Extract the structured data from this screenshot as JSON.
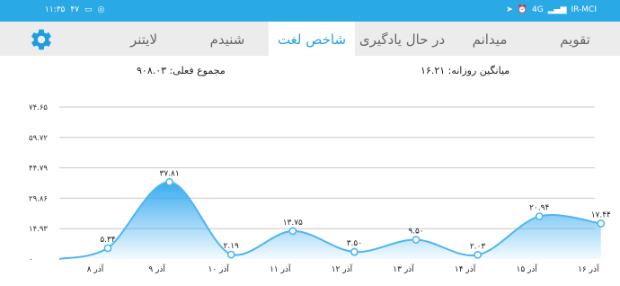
{
  "status_bar": {
    "time": "۱۱:۳۵",
    "data_rate": "۴۷",
    "carrier": "IR-MCI",
    "network_type": "4G"
  },
  "tabs": [
    {
      "label": "تقویم",
      "active": false
    },
    {
      "label": "میدانم",
      "active": false
    },
    {
      "label": "در حال یادگیری",
      "active": false
    },
    {
      "label": "شاخص لغت",
      "active": true
    },
    {
      "label": "شنیدم",
      "active": false
    },
    {
      "label": "لایتنر",
      "active": false
    }
  ],
  "stats": {
    "daily_average": "میانگین روزانه: ۱۶.۲۱",
    "current_total": "مجموع فعلی: ۹۰۸.۰۳"
  },
  "colors": {
    "status_bar": "#29a9e6",
    "accent": "#25a2e2",
    "tab_bar": "#ececec",
    "line": "#4db6f2"
  },
  "chart_data": {
    "type": "area",
    "y_ticks": [
      "۷۴.۶۵",
      "۵۹.۷۲",
      "۴۴.۷۹",
      "۲۹.۸۶",
      "۱۴.۹۳",
      "۰"
    ],
    "ylim": [
      0,
      74.65
    ],
    "x": [
      "۸ آذر",
      "۹ آذر",
      "۱۰ آذر",
      "۱۱ آذر",
      "۱۲ آذر",
      "۱۳ آذر",
      "۱۴ آذر",
      "۱۵ آذر",
      "۱۶ آذر"
    ],
    "values": [
      5.34,
      37.81,
      2.19,
      13.75,
      3.5,
      9.5,
      2.03,
      20.94,
      17.44
    ],
    "point_labels": [
      "۵.۳۴",
      "۳۷.۸۱",
      "۲.۱۹",
      "۱۳.۷۵",
      "۳.۵۰",
      "۹.۵۰",
      "۲.۰۳",
      "۲۰.۹۴",
      "۱۷.۴۴"
    ],
    "grid": true
  }
}
